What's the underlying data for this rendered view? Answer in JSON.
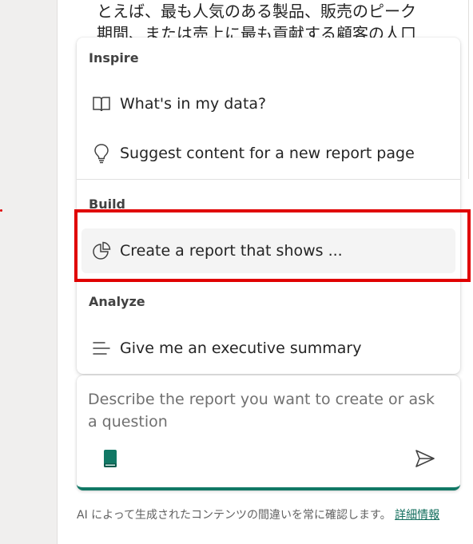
{
  "background_text": {
    "lines": [
      "とえば、最も人気のある製品、販売のピーク",
      "期間、または売上に最も貢献する顧客の人口"
    ]
  },
  "menu": {
    "sections": {
      "inspire": {
        "header": "Inspire",
        "items": [
          {
            "label": "What's in my data?",
            "icon": "book-open-icon"
          },
          {
            "label": "Suggest content for a new report page",
            "icon": "lightbulb-icon"
          }
        ]
      },
      "build": {
        "header": "Build",
        "items": [
          {
            "label": "Create a report that shows ...",
            "icon": "pie-chart-icon"
          }
        ]
      },
      "analyze": {
        "header": "Analyze",
        "items": [
          {
            "label": "Give me an executive summary",
            "icon": "text-summary-icon"
          }
        ]
      }
    }
  },
  "composer": {
    "placeholder": "Describe the report you want to create or ask a question",
    "prompt_guide_icon": "prompt-book-icon",
    "send_icon": "send-icon"
  },
  "disclaimer": {
    "text": "AI によって生成されたコンテンツの間違いを常に確認します。",
    "link": "詳細情報"
  },
  "colors": {
    "accent": "#117865",
    "highlight": "#e00000",
    "pane": "#f0efee"
  }
}
